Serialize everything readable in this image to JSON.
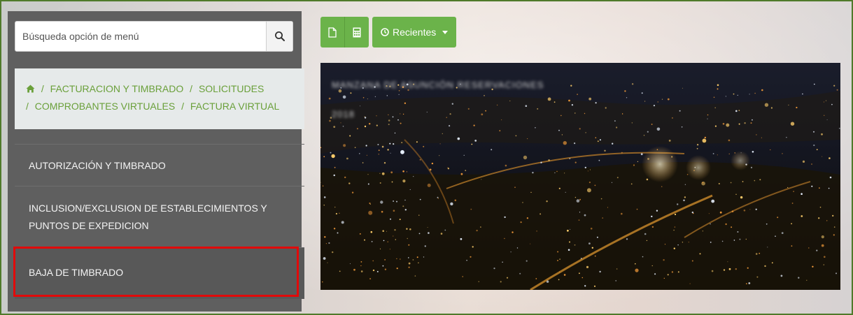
{
  "search": {
    "placeholder": "Búsqueda opción de menú",
    "button_icon": "search-icon"
  },
  "breadcrumb": {
    "home_icon": "home-icon",
    "items": [
      "FACTURACION Y TIMBRADO",
      "SOLICITUDES",
      "COMPROBANTES VIRTUALES",
      "FACTURA VIRTUAL"
    ],
    "separator": "/"
  },
  "menu": {
    "items": [
      {
        "label": "AUTORIZACIÓN Y TIMBRADO"
      },
      {
        "label": "INCLUSION/EXCLUSION DE ESTABLECIMIENTOS Y PUNTOS DE EXPEDICION"
      },
      {
        "label": "BAJA DE TIMBRADO",
        "highlighted": true
      }
    ]
  },
  "toolbar": {
    "new_icon": "file-icon",
    "calc_icon": "calculator-icon",
    "recent_icon": "clock-icon",
    "recent_label": "Recientes"
  },
  "banner": {
    "image": "night-city-aerial",
    "caption_line1": "MANZANA DE ASUNCIÓN RESERVACIONES",
    "caption_line2": "2018"
  },
  "colors": {
    "accent_green": "#6bb34a",
    "breadcrumb_green": "#6aa03a",
    "sidebar_bg": "#5f5f5f",
    "highlight_red": "#e10a0a",
    "frame_border": "#4f7a2a"
  }
}
